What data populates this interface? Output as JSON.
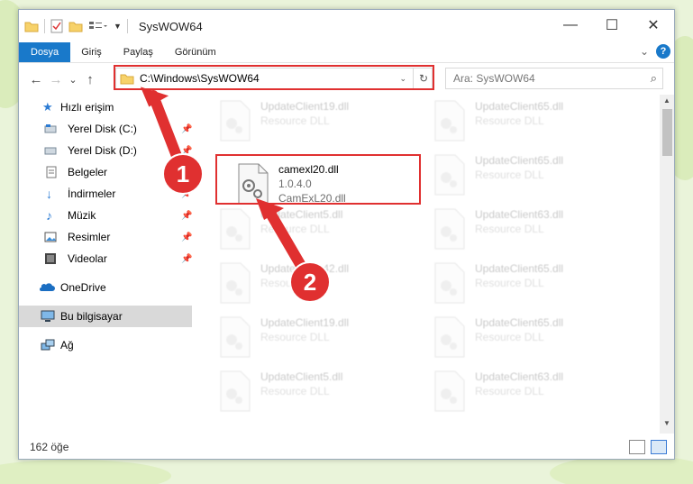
{
  "window": {
    "title": "SysWOW64",
    "minimize_glyph": "—",
    "maximize_glyph": "☐",
    "close_glyph": "✕"
  },
  "ribbon": {
    "tabs": [
      "Dosya",
      "Giriş",
      "Paylaş",
      "Görünüm"
    ],
    "help_glyph": "?",
    "expand_glyph": "⌄"
  },
  "address": {
    "path": "C:\\Windows\\SysWOW64",
    "back_glyph": "←",
    "forward_glyph": "→",
    "recent_glyph": "⌄",
    "up_glyph": "↑",
    "dropdown_glyph": "⌄",
    "refresh_glyph": "↻"
  },
  "search": {
    "placeholder": "Ara: SysWOW64",
    "icon_glyph": "⌕"
  },
  "nav": {
    "items": [
      {
        "label": "Hızlı erişim",
        "icon": "star-icon",
        "pinned": false
      },
      {
        "label": "Yerel Disk (C:)",
        "icon": "drive-icon",
        "pinned": true
      },
      {
        "label": "Yerel Disk (D:)",
        "icon": "drive-icon",
        "pinned": true
      },
      {
        "label": "Belgeler",
        "icon": "documents-icon",
        "pinned": true
      },
      {
        "label": "İndirmeler",
        "icon": "downloads-icon",
        "pinned": true
      },
      {
        "label": "Müzik",
        "icon": "music-icon",
        "pinned": true
      },
      {
        "label": "Resimler",
        "icon": "pictures-icon",
        "pinned": true
      },
      {
        "label": "Videolar",
        "icon": "videos-icon",
        "pinned": true
      },
      {
        "label": "OneDrive",
        "icon": "onedrive-icon",
        "pinned": false
      },
      {
        "label": "Bu bilgisayar",
        "icon": "computer-icon",
        "pinned": false,
        "selected": true
      },
      {
        "label": "Ağ",
        "icon": "network-icon",
        "pinned": false
      }
    ],
    "pin_glyph": "📌"
  },
  "files": {
    "highlighted": {
      "name": "camexl20.dll",
      "version": "1.0.4.0",
      "description": "CamExL20.dll"
    },
    "faded": [
      {
        "name": "UpdateClient19.dll",
        "type": "Resource DLL"
      },
      {
        "name": "UpdateClient65.dll",
        "type": "Resource DLL"
      },
      {
        "name": "UpdateClient65.dll",
        "type": "Resource DLL"
      },
      {
        "name": "UpdateClient5.dll",
        "type": "Resource DLL"
      },
      {
        "name": "UpdateClient63.dll",
        "type": "Resource DLL"
      },
      {
        "name": "UpdateClient42.dll",
        "type": "Resource DLL"
      },
      {
        "name": "UpdateClient65.dll",
        "type": "Resource DLL"
      },
      {
        "name": "UpdateClient19.dll",
        "type": "Resource DLL"
      },
      {
        "name": "UpdateClient65.dll",
        "type": "Resource DLL"
      },
      {
        "name": "UpdateClient5.dll",
        "type": "Resource DLL"
      },
      {
        "name": "UpdateClient63.dll",
        "type": "Resource DLL"
      }
    ]
  },
  "status": {
    "count": "162 öğe"
  },
  "annotations": {
    "step1": "1",
    "step2": "2",
    "color": "#e03030"
  }
}
